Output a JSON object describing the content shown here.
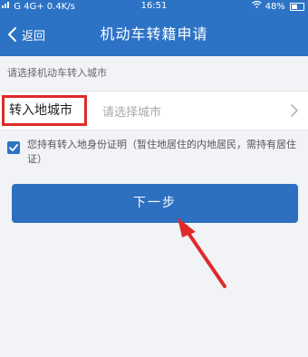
{
  "status_bar": {
    "left_text": "G 4G+ 0.4K/s",
    "time": "16:51",
    "battery_text": "48%",
    "battery_level": 0.48
  },
  "header": {
    "back_label": "返回",
    "title": "机动车转籍申请"
  },
  "form": {
    "section_hint": "请选择机动车转入城市",
    "city_label": "转入地城市",
    "city_placeholder": "请选择城市",
    "agreement_checked": true,
    "agreement_text": "您持有转入地身份证明（暂住地居住的内地居民，需持有居住证）"
  },
  "actions": {
    "next_label": "下一步"
  },
  "colors": {
    "brand": "#2c73c6",
    "annotation": "#e02a2a"
  },
  "icons": {
    "back": "chevron-left-icon",
    "city_arrow": "chevron-right-icon",
    "checkbox": "checkmark-icon"
  }
}
